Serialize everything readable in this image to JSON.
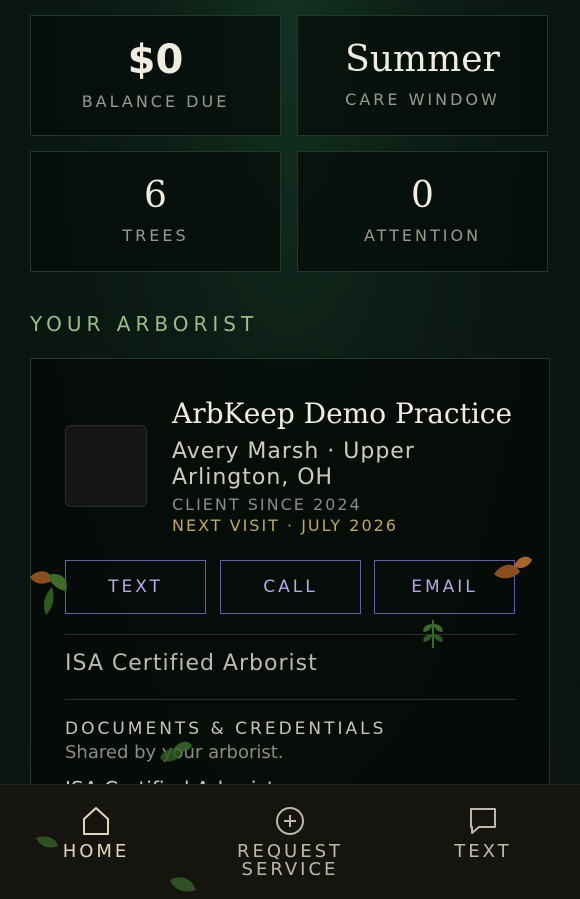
{
  "stats": [
    {
      "value": "$0",
      "label": "BALANCE DUE"
    },
    {
      "value": "Summer",
      "label": "CARE WINDOW"
    },
    {
      "value": "6",
      "label": "TREES"
    },
    {
      "value": "0",
      "label": "ATTENTION"
    }
  ],
  "arborist_section": {
    "heading": "YOUR ARBORIST",
    "practice_name": "ArbKeep Demo Practice",
    "person_location": "Avery Marsh · Upper Arlington, OH",
    "client_since": "CLIENT SINCE 2024",
    "next_visit": "NEXT VISIT · JULY 2026",
    "buttons": {
      "text": "TEXT",
      "call": "CALL",
      "email": "EMAIL"
    },
    "certification": "ISA Certified Arborist",
    "documents": {
      "title": "DOCUMENTS & CREDENTIALS",
      "subtitle": "Shared by your arborist.",
      "first_item": "ISA Certified Arborist"
    }
  },
  "bottom_nav": {
    "home": "HOME",
    "request_service": "REQUEST SERVICE",
    "text": "TEXT"
  },
  "colors": {
    "background": "#0b1a13",
    "accent_green": "#9dbb88",
    "accent_gold": "#bfa95a",
    "button_purple": "#6c5aa3"
  },
  "icons": [
    "home-icon",
    "plus-circle-icon",
    "chat-bubble-icon",
    "leaf-icon"
  ]
}
